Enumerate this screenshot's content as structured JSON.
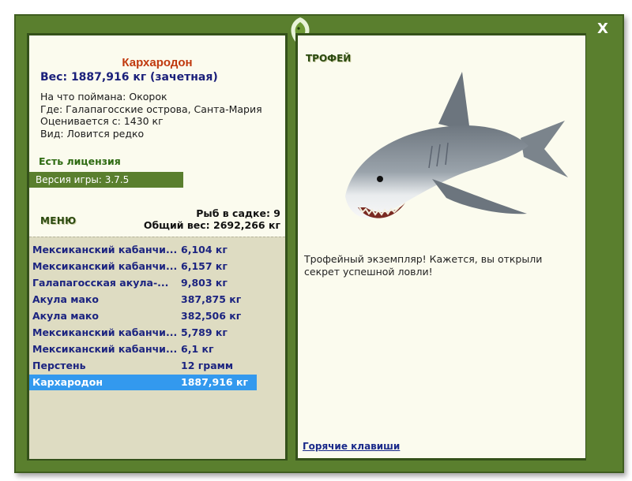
{
  "window": {
    "close_label": "X"
  },
  "fish": {
    "name": "Кархародон",
    "weight_line": "Вес: 1887,916 кг (зачетная)",
    "bait_line": "На что поймана: Окорок",
    "location_line": "Где: Галапагосские острова, Санта-Мария",
    "rated_line": "Оценивается с: 1430 кг",
    "type_line": "Вид: Ловится редко"
  },
  "license_label": "Есть лицензия",
  "version_label": "Версия игры: 3.7.5",
  "menu_label": "МЕНЮ",
  "stats": {
    "fish_in_keepnet": "Рыб в садке: 9",
    "total_weight": "Общий вес: 2692,266 кг"
  },
  "catch_list": [
    {
      "name": "Мексиканский кабанчи...",
      "weight": "6,104 кг"
    },
    {
      "name": "Мексиканский кабанчи...",
      "weight": "6,157 кг"
    },
    {
      "name": "Галапагосская акула-...",
      "weight": "9,803 кг"
    },
    {
      "name": "Акула мако",
      "weight": "387,875 кг"
    },
    {
      "name": "Акула мако",
      "weight": "382,506 кг"
    },
    {
      "name": "Мексиканский кабанчи...",
      "weight": "5,789 кг"
    },
    {
      "name": "Мексиканский кабанчи...",
      "weight": "6,1 кг"
    },
    {
      "name": "Перстень",
      "weight": "12 грамм"
    },
    {
      "name": "Кархародон",
      "weight": "1887,916 кг",
      "selected": true
    }
  ],
  "trophy": {
    "title": "ТРОФЕЙ",
    "image": "shark-illustration",
    "text": "Трофейный экземпляр! Кажется, вы открыли секрет успешной ловли!"
  },
  "hotkeys_label": "Горячие клавиши",
  "colors": {
    "frame_green": "#5a7f2e",
    "panel_bg": "#fbfbee",
    "list_bg": "#dedcc2",
    "selection_blue": "#3399ee",
    "name_red": "#c0390e",
    "link_blue": "#1c2480"
  }
}
